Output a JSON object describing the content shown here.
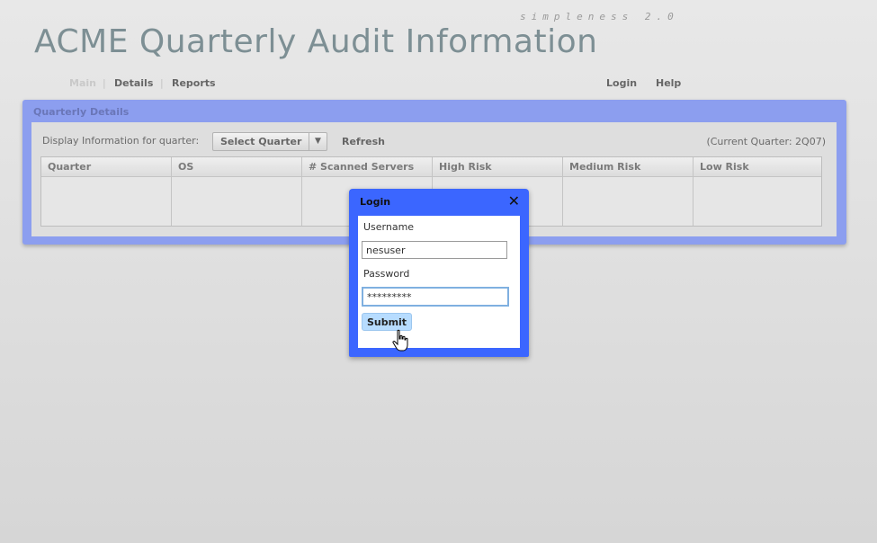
{
  "header": {
    "tagline": "simpleness 2.0",
    "title": "ACME Quarterly Audit Information"
  },
  "nav": {
    "main": "Main",
    "details": "Details",
    "reports": "Reports",
    "login": "Login",
    "help": "Help",
    "separator": "|"
  },
  "panel": {
    "title": "Quarterly Details",
    "filter_label": "Display Information for quarter:",
    "select_value": "Select Quarter",
    "refresh_label": "Refresh",
    "current_quarter": "(Current Quarter: 2Q07)",
    "columns": [
      "Quarter",
      "OS",
      "# Scanned Servers",
      "High Risk",
      "Medium Risk",
      "Low Risk"
    ]
  },
  "login_dialog": {
    "title": "Login",
    "close_symbol": "✕",
    "username_label": "Username",
    "username_value": "nesuser",
    "password_label": "Password",
    "password_value": "*********",
    "submit_label": "Submit"
  },
  "colors": {
    "panel": "#8c9eef",
    "dialog": "#3b66ff",
    "submit": "#b7dcff",
    "title": "#7d8f94"
  },
  "icons": {
    "close": "close-icon",
    "dropdown": "chevron-down-icon",
    "cursor": "hand-pointer-icon"
  }
}
